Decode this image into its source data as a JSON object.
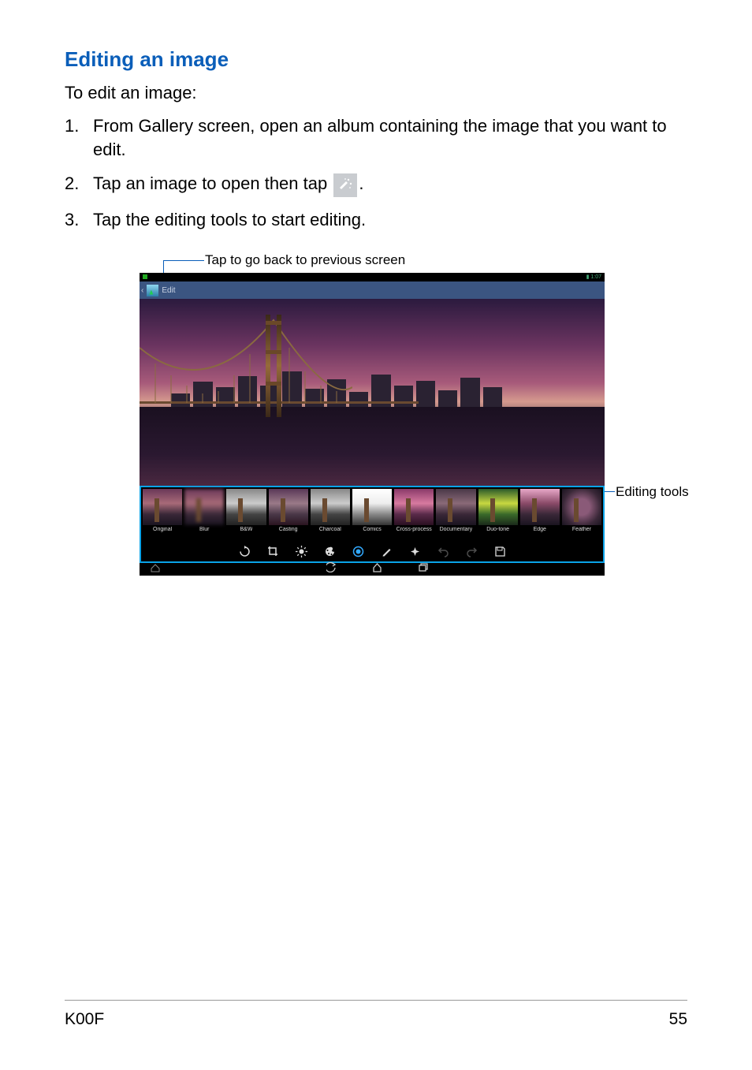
{
  "heading": "Editing an image",
  "intro": "To edit an image:",
  "steps": [
    {
      "num": "1.",
      "text": "From Gallery screen, open an album containing the image that you want to edit."
    },
    {
      "num": "2.",
      "text_before": "Tap an image to open then tap ",
      "text_after": "."
    },
    {
      "num": "3.",
      "text": "Tap the editing tools to start editing."
    }
  ],
  "annotations": {
    "top": "Tap to go back to previous screen",
    "right": "Editing tools"
  },
  "screenshot": {
    "status_time": "1:07",
    "header_label": "Edit",
    "filters": [
      "Original",
      "Blur",
      "B&W",
      "Casting",
      "Charcoal",
      "Comics",
      "Cross-process",
      "Documentary",
      "Duo-tone",
      "Edge",
      "Feather"
    ],
    "tools": [
      "rotate",
      "crop",
      "brightness",
      "artistic",
      "vignette",
      "draw",
      "sparkle",
      "undo",
      "redo",
      "save"
    ]
  },
  "footer": {
    "model": "K00F",
    "page": "55"
  }
}
